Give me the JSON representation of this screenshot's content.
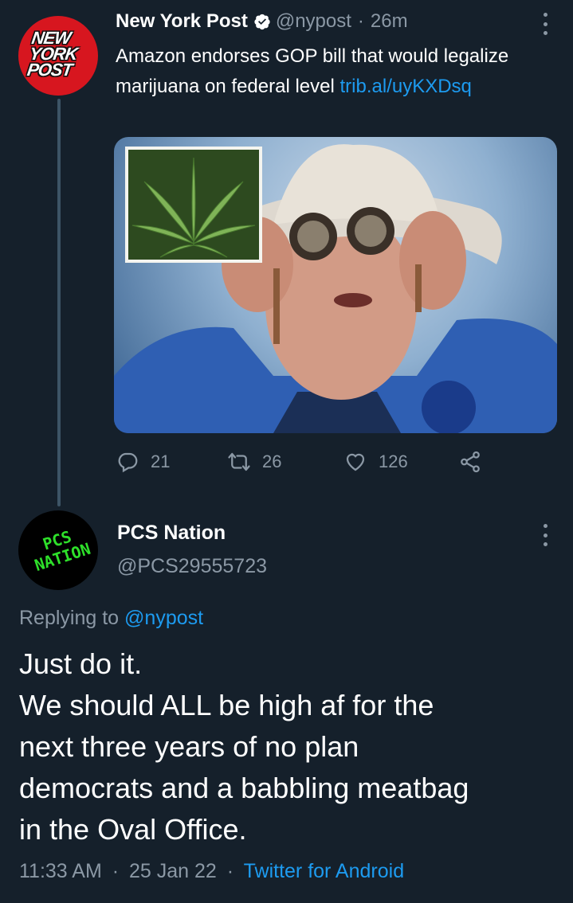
{
  "tweet": {
    "author_name": "New York Post",
    "author_handle": "@nypost",
    "separator": "·",
    "time_ago": "26m",
    "avatar_logo": [
      "NEW",
      "YORK",
      "POST"
    ],
    "text": "Amazon endorses GOP bill that would legalize marijuana on federal level ",
    "link": "trib.al/uyKXDsq",
    "actions": {
      "replies": "21",
      "retweets": "26",
      "likes": "126"
    }
  },
  "reply": {
    "author_name": "PCS Nation",
    "author_handle": "@PCS29555723",
    "avatar_logo": [
      "PCS",
      "NATION"
    ],
    "replying_prefix": "Replying to ",
    "replying_to": "@nypost",
    "text_lines": [
      "Just do it.",
      "We should ALL be high af for the",
      "next three years of no plan",
      "democrats and a babbling meatbag",
      "in the Oval Office."
    ],
    "time": "11:33 AM",
    "date": "25 Jan 22",
    "source": "Twitter for Android",
    "separator": "·"
  },
  "colors": {
    "background": "#15202b",
    "link": "#1d9bf0",
    "muted": "#8b98a5",
    "nypost_red": "#d7161f",
    "pcs_green": "#2ee02a"
  }
}
